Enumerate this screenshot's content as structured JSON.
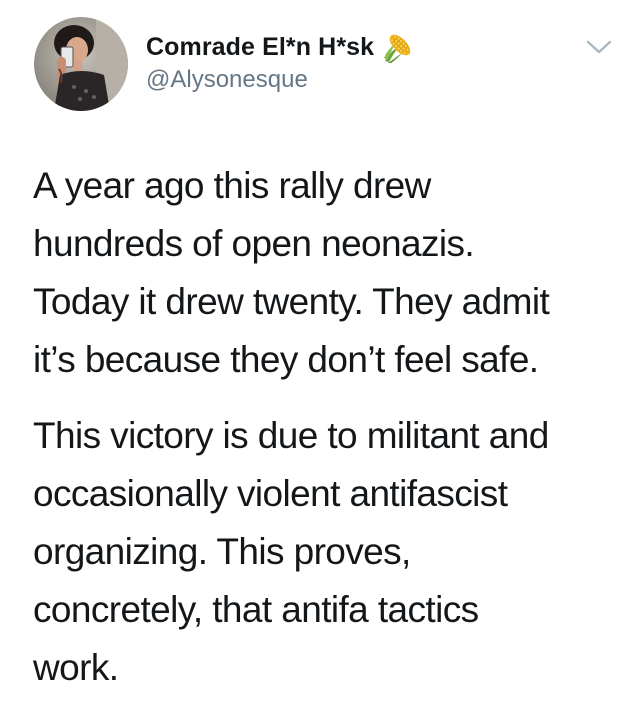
{
  "tweet": {
    "author": {
      "display_name": "Comrade El*n H*sk",
      "handle": "@Alysonesque",
      "name_emoji_icon": "corn-emoji-icon",
      "avatar_icon": "avatar-photo"
    },
    "menu_icon": "chevron-down-icon",
    "paragraphs": [
      "A year ago this rally drew\nhundreds of open neonazis.\nToday it drew twenty. They admit\nit’s because they don’t feel safe.",
      "This victory is due to militant and\noccasionally violent antifascist\norganizing. This proves,\nconcretely, that antifa tactics\nwork."
    ]
  },
  "colors": {
    "text_primary": "#14171a",
    "text_secondary": "#657786",
    "chevron": "#aab8c2",
    "background": "#ffffff"
  }
}
